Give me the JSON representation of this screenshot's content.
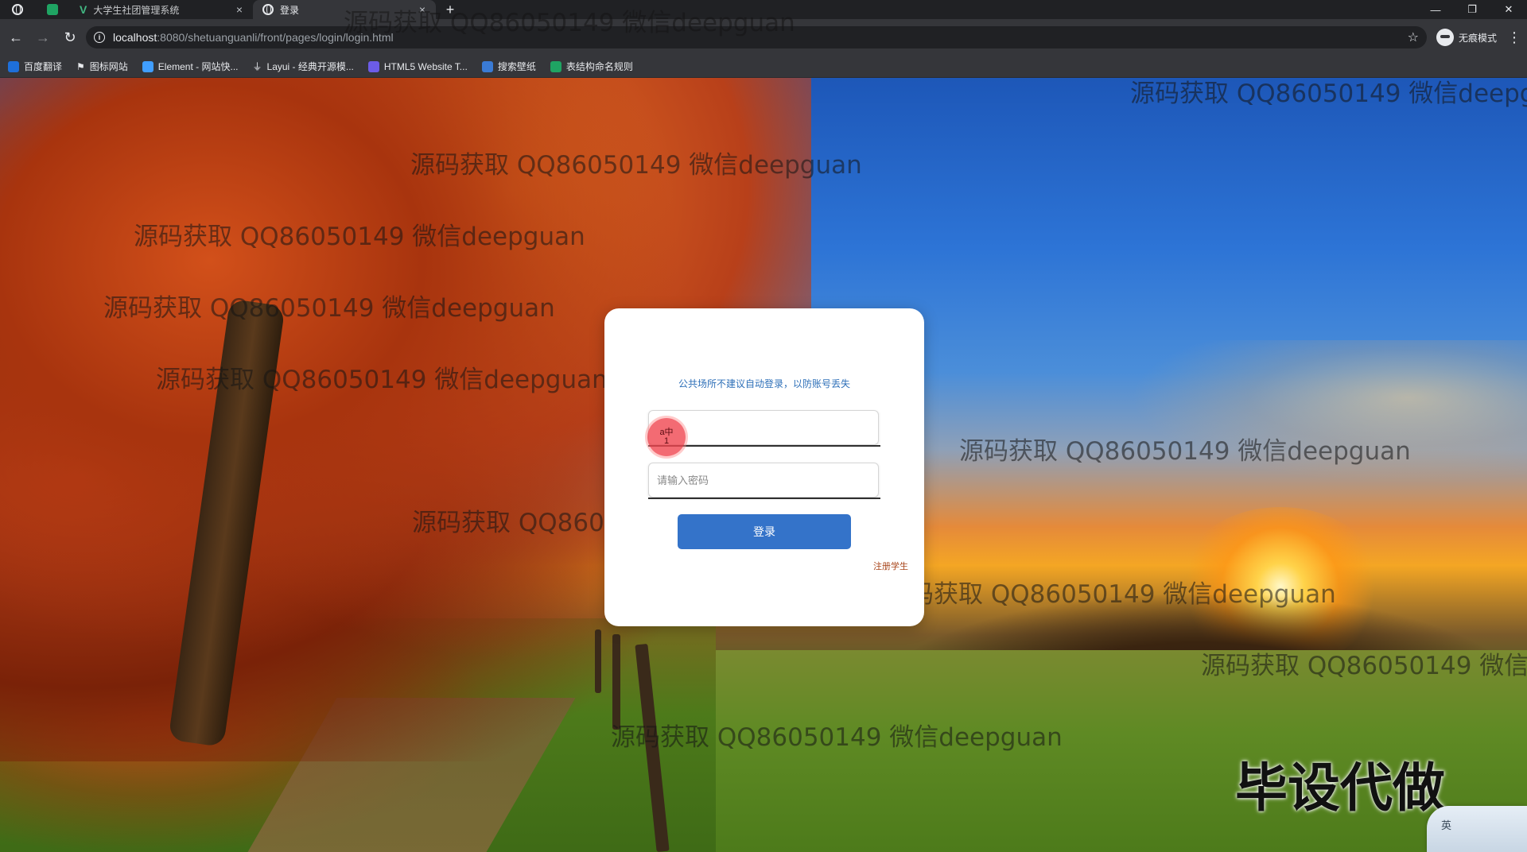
{
  "browser": {
    "tabs": [
      {
        "label": "大学生社团管理系统"
      },
      {
        "label": "登录"
      }
    ],
    "address": {
      "host": "localhost",
      "path": ":8080/shetuanguanli/front/pages/login/login.html"
    },
    "profile_label": "无痕模式",
    "bookmarks": [
      {
        "label": "百度翻译",
        "color": "#1e6fd9"
      },
      {
        "label": "图标网站",
        "color": "#e8eaed"
      },
      {
        "label": "Element - 网站快...",
        "color": "#409eff"
      },
      {
        "label": "Layui - 经典开源模...",
        "color": "#9aa0a6"
      },
      {
        "label": "HTML5 Website T...",
        "color": "#6c5ce7"
      },
      {
        "label": "搜索壁纸",
        "color": "#3a7bd5"
      },
      {
        "label": "表结构命名规则",
        "color": "#1fa463"
      }
    ]
  },
  "login": {
    "tip": "公共场所不建议自动登录，以防账号丢失",
    "username": {
      "value": "",
      "placeholder": ""
    },
    "password": {
      "value": "",
      "placeholder": "请输入密码"
    },
    "cursor_text": "a中\n1",
    "login_button": "登录",
    "register_link": "注册学生"
  },
  "watermarks": {
    "text": "源码获取 QQ86050149 微信deepguan",
    "partial_short": "源码获取 QQ86050149 微信d",
    "partial_long": "源码获取 QQ86050149 微信deepgu",
    "big": "毕设代做"
  },
  "ime": {
    "label": "英"
  },
  "colors": {
    "accent": "#3473c9",
    "tip": "#2d6fb8",
    "register": "#a8451a"
  }
}
